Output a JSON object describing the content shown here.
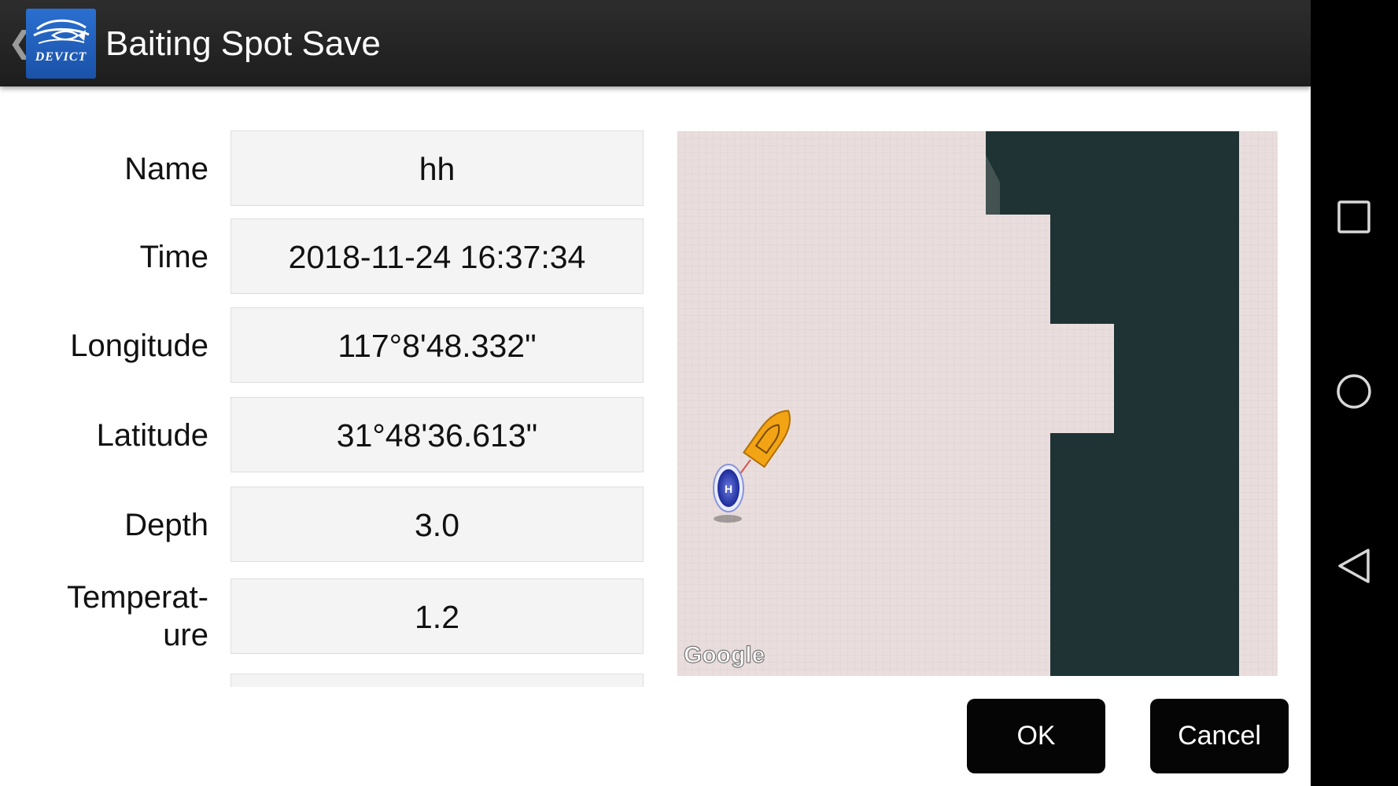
{
  "header": {
    "title": "Baiting Spot Save",
    "back_icon": "back-chevron-icon",
    "logo_text": "DEVICT"
  },
  "form": {
    "fields": [
      {
        "label": "Name",
        "value": "hh"
      },
      {
        "label": "Time",
        "value": "2018-11-24 16:37:34"
      },
      {
        "label": "Longitude",
        "value": "117°8'48.332\""
      },
      {
        "label": "Latitude",
        "value": "31°48'36.613\""
      },
      {
        "label": "Depth",
        "value": "3.0"
      },
      {
        "label_line1": "Temperat-",
        "label_line2": "ure",
        "value": "1.2"
      }
    ]
  },
  "map": {
    "attribution": "Google",
    "home_marker_letter": "H",
    "boat_icon": "boat-icon",
    "home_icon": "home-marker-icon"
  },
  "actions": {
    "ok_label": "OK",
    "cancel_label": "Cancel"
  },
  "system_nav": {
    "recents_icon": "recents-square-icon",
    "home_icon": "home-circle-icon",
    "back_icon": "back-triangle-icon"
  },
  "colors": {
    "header_bg": "#222222",
    "logo_blue": "#1f5fbf",
    "button_bg": "#050505",
    "water": "#1f3334",
    "land": "#e9dedd",
    "boat": "#f2a414"
  }
}
